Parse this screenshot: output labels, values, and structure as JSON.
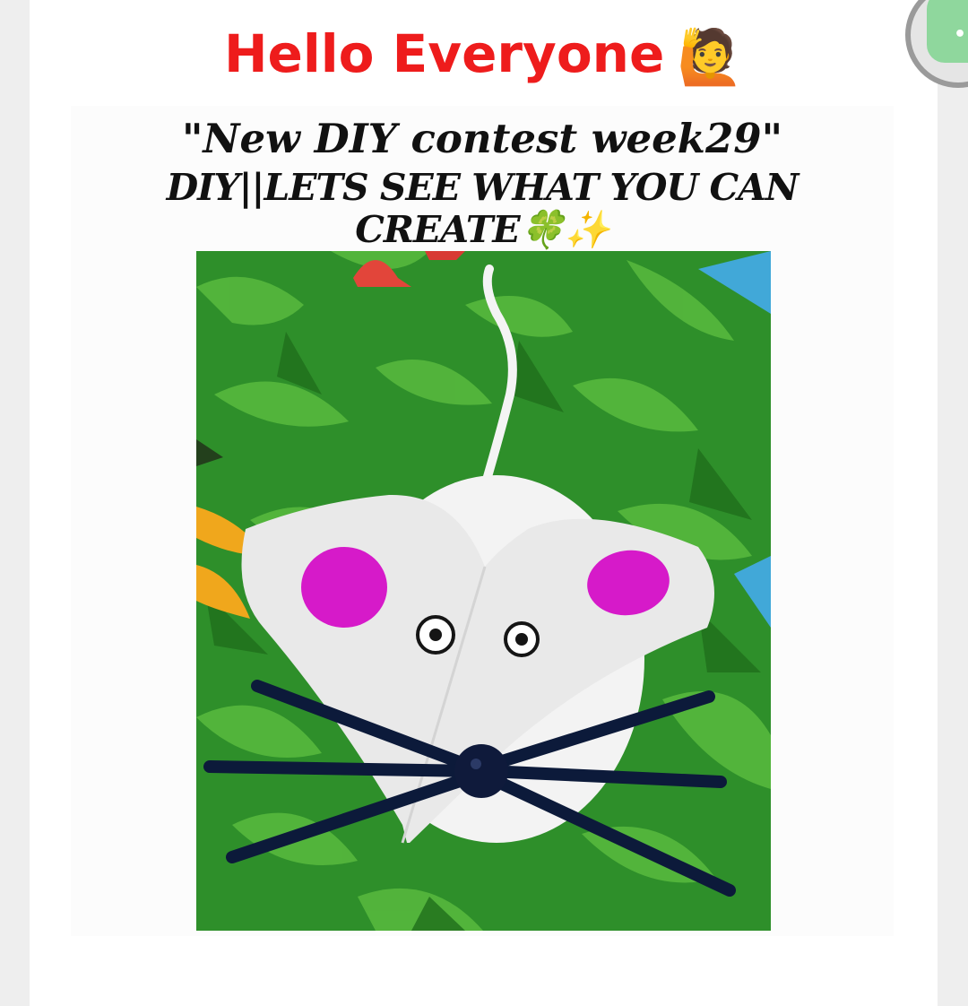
{
  "post": {
    "greeting": "Hello Everyone",
    "greeting_emoji": "🙋",
    "greeting_color": "#ee1c1c",
    "image": {
      "caption_line1": "\"New DIY contest week29\"",
      "caption_line2": "DIY||LETS SEE WHAT YOU CAN",
      "caption_line3": "CREATE🍀✨",
      "subject": "paper mouse craft on green leaf-patterned cloth"
    }
  },
  "floating_button": {
    "icon": "chat-bubble-icon",
    "label": "••",
    "color": "#8fd79d"
  }
}
